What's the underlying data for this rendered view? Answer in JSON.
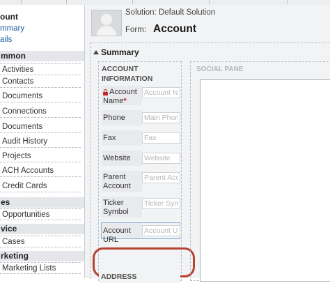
{
  "nav": {
    "top": [
      "ount",
      "mmary",
      "ails"
    ],
    "groups": [
      {
        "label": "mmon",
        "items": [
          "Activities",
          "Contacts",
          "Documents",
          "Connections",
          "Documents",
          "Audit History",
          "Projects",
          "ACH Accounts",
          "Credit Cards"
        ]
      },
      {
        "label": "es",
        "items": [
          "Opportunities"
        ]
      },
      {
        "label": "vice",
        "items": [
          "Cases"
        ]
      },
      {
        "label": "rketing",
        "items": [
          "Marketing Lists"
        ]
      }
    ]
  },
  "header": {
    "solution": "Solution: Default Solution",
    "form_label": "Form:",
    "form_name": "Account"
  },
  "section": {
    "title": "Summary",
    "account_info_header": "ACCOUNT INFORMATION",
    "social_pane_header": "SOCIAL PANE",
    "address_header": "ADDRESS",
    "fields": [
      {
        "label": "Account Name",
        "placeholder": "Account Name",
        "required": true,
        "required_mark": "*"
      },
      {
        "label": "Phone",
        "placeholder": "Main Phone"
      },
      {
        "label": "Fax",
        "placeholder": "Fax"
      },
      {
        "label": "Website",
        "placeholder": "Website"
      },
      {
        "label": "Parent Account",
        "placeholder": "Parent Account"
      },
      {
        "label": "Ticker Symbol",
        "placeholder": "Ticker Symbol"
      },
      {
        "label": "Account URL",
        "placeholder": "Account URL"
      }
    ]
  },
  "colors": {
    "highlight_ring": "#b54332",
    "required": "#c0262b",
    "link": "#1f5ea8"
  }
}
